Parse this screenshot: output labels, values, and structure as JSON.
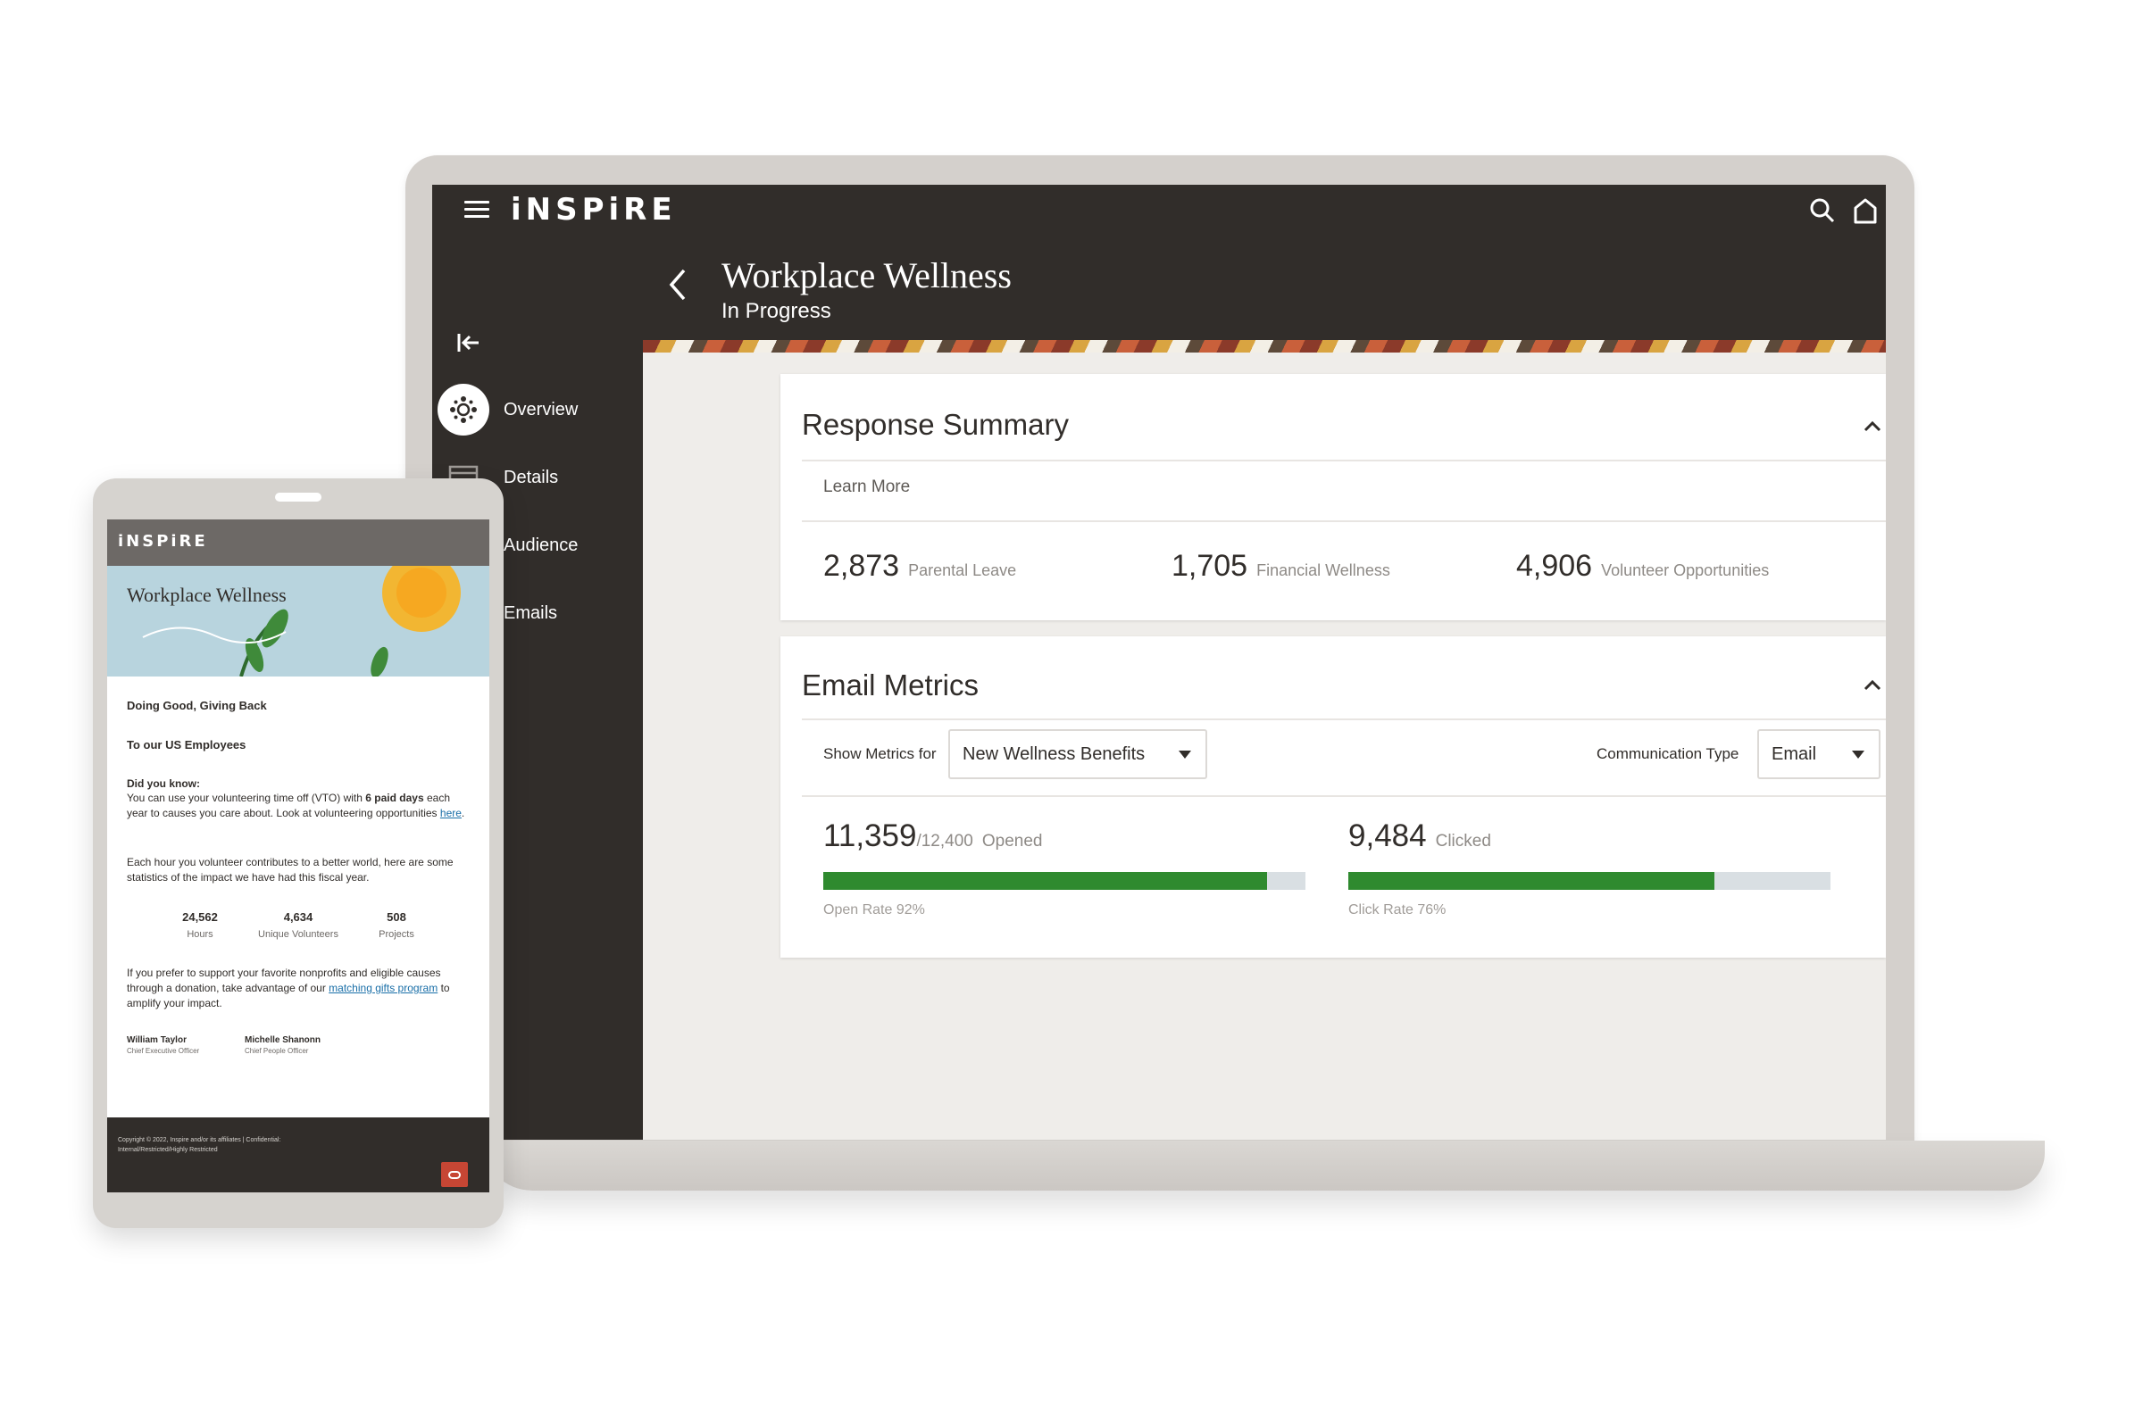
{
  "app": {
    "brand": "iNSPiRE",
    "page_title": "Workplace Wellness",
    "page_status": "In Progress"
  },
  "sidebar": {
    "items": [
      {
        "label": "Overview",
        "icon": "overview-icon",
        "active": true
      },
      {
        "label": "Details",
        "icon": "details-icon",
        "active": false
      },
      {
        "label": "Audience",
        "icon": "audience-icon",
        "active": false
      },
      {
        "label": "Emails",
        "icon": "emails-icon",
        "active": false
      }
    ]
  },
  "response_summary": {
    "title": "Response Summary",
    "learn_more": "Learn More",
    "metrics": [
      {
        "value": "2,873",
        "label": "Parental Leave"
      },
      {
        "value": "1,705",
        "label": "Financial Wellness"
      },
      {
        "value": "4,906",
        "label": "Volunteer Opportunities"
      }
    ]
  },
  "email_metrics": {
    "title": "Email Metrics",
    "show_metrics_for_label": "Show Metrics for",
    "show_metrics_for_value": "New Wellness Benefits",
    "communication_type_label": "Communication Type",
    "communication_type_value": "Email",
    "opened": {
      "value": "11,359",
      "total": "/12,400",
      "label": "Opened",
      "rate_text": "Open Rate 92%",
      "rate": 0.92
    },
    "clicked": {
      "value": "9,484",
      "label": "Clicked",
      "rate_text": "Click Rate 76%",
      "rate": 0.76
    }
  },
  "colors": {
    "dark": "#312d2a",
    "progress": "#2f8a2f",
    "track": "#d9dfe3",
    "accent_red": "#c74634"
  },
  "email_preview": {
    "brand": "iNSPiRE",
    "hero_title": "Workplace Wellness",
    "heading": "Doing Good, Giving Back",
    "greeting": "To our US Employees",
    "did_you_know": "Did you know:",
    "p1_start": "You can use your volunteering time off (VTO) with ",
    "p1_bold": "6 paid days",
    "p1_end": " each year to causes you care about. Look at volunteering opportunities ",
    "p1_link": "here",
    "p1_tail": ".",
    "p2": "Each hour you volunteer contributes to a better world, here are some statistics of the impact we have had this fiscal year.",
    "stats": [
      {
        "value": "24,562",
        "label": "Hours"
      },
      {
        "value": "4,634",
        "label": "Unique Volunteers"
      },
      {
        "value": "508",
        "label": "Projects"
      }
    ],
    "p3_start": "If you prefer to support your favorite nonprofits and eligible causes through a donation, take advantage of our ",
    "p3_link": "matching gifts program",
    "p3_end": " to amplify your impact.",
    "signers": [
      {
        "name": "William Taylor",
        "role": "Chief Executive Officer"
      },
      {
        "name": "Michelle Shanonn",
        "role": "Chief People Officer"
      }
    ],
    "footer_line1": "Copyright © 2022, Inspire and/or its affiliates | Confidential:",
    "footer_line2": "Internal/Restricted/Highly Restricted"
  }
}
